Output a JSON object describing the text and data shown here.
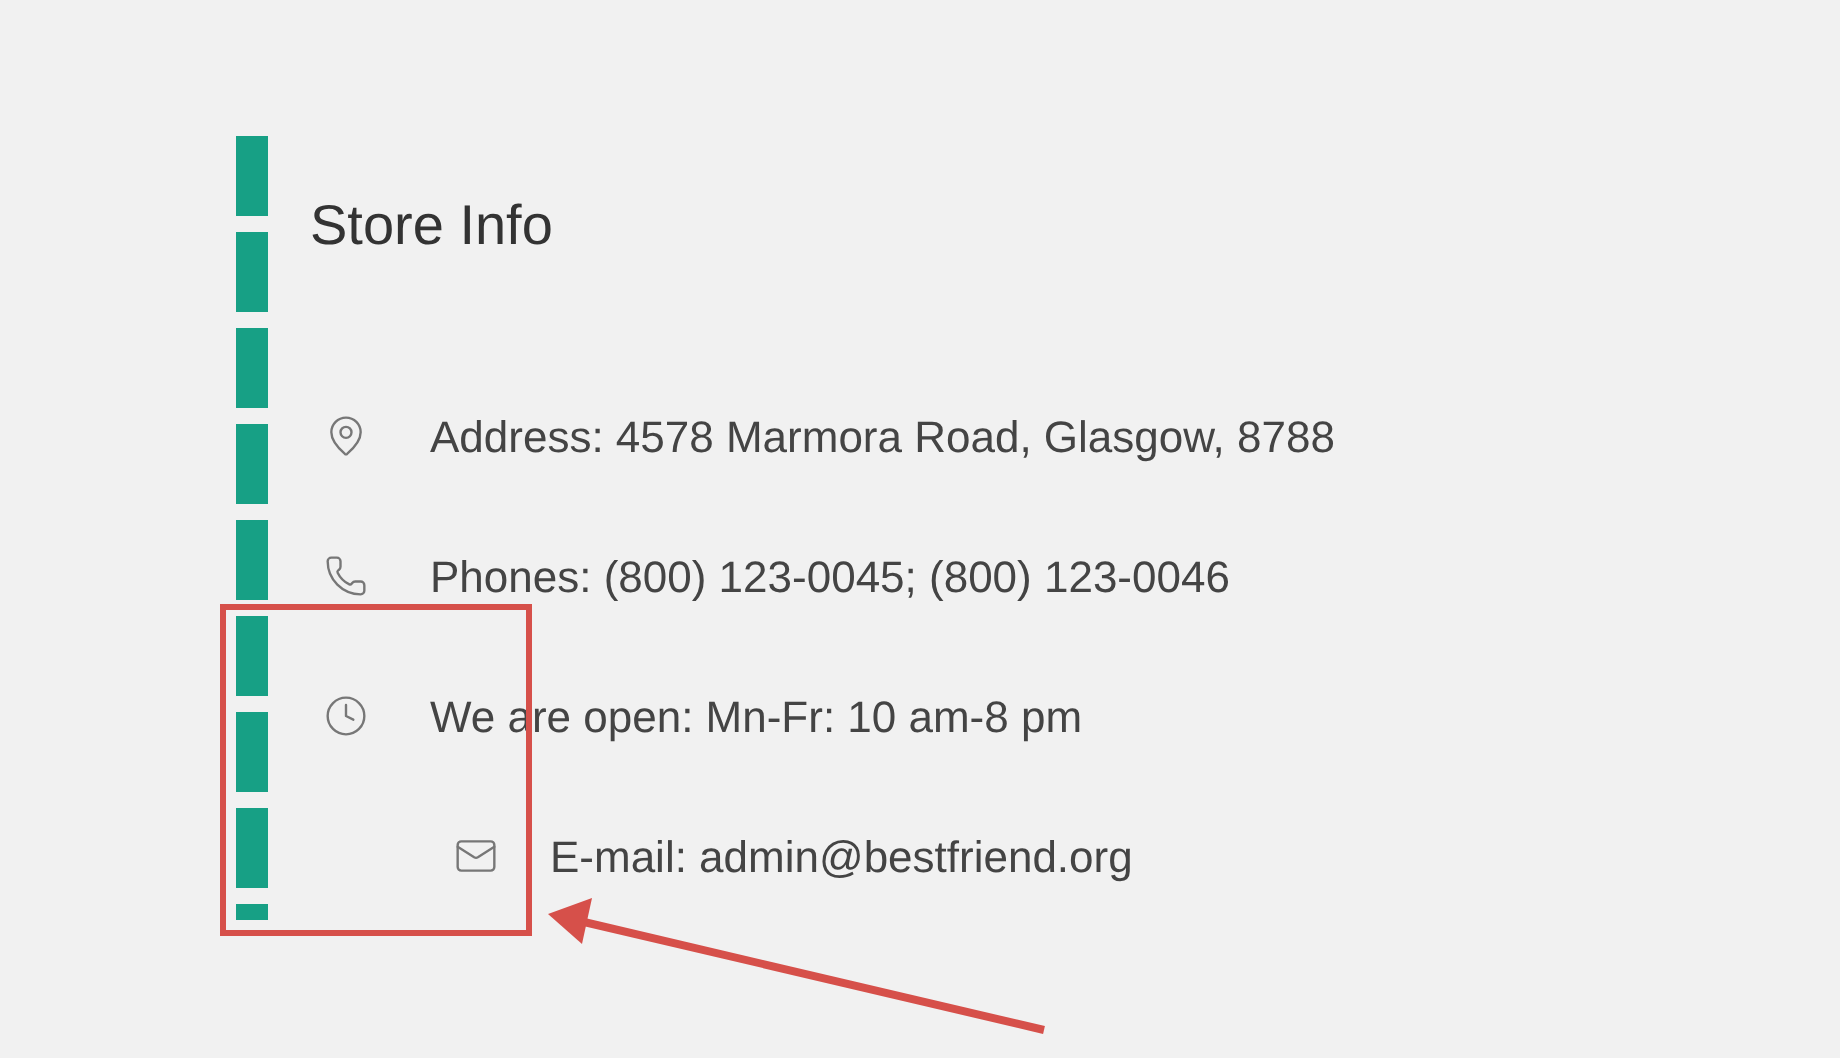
{
  "title": "Store Info",
  "items": [
    {
      "kind": "address",
      "text": "Address: 4578 Marmora Road, Glasgow, 8788",
      "indented": false
    },
    {
      "kind": "phone",
      "text": "Phones: (800) 123-0045; (800) 123-0046",
      "indented": false
    },
    {
      "kind": "hours",
      "text": "We are open: Mn-Fr: 10 am-8 pm",
      "indented": false
    },
    {
      "kind": "email",
      "text": "E-mail: admin@bestfriend.org",
      "indented": true
    }
  ]
}
